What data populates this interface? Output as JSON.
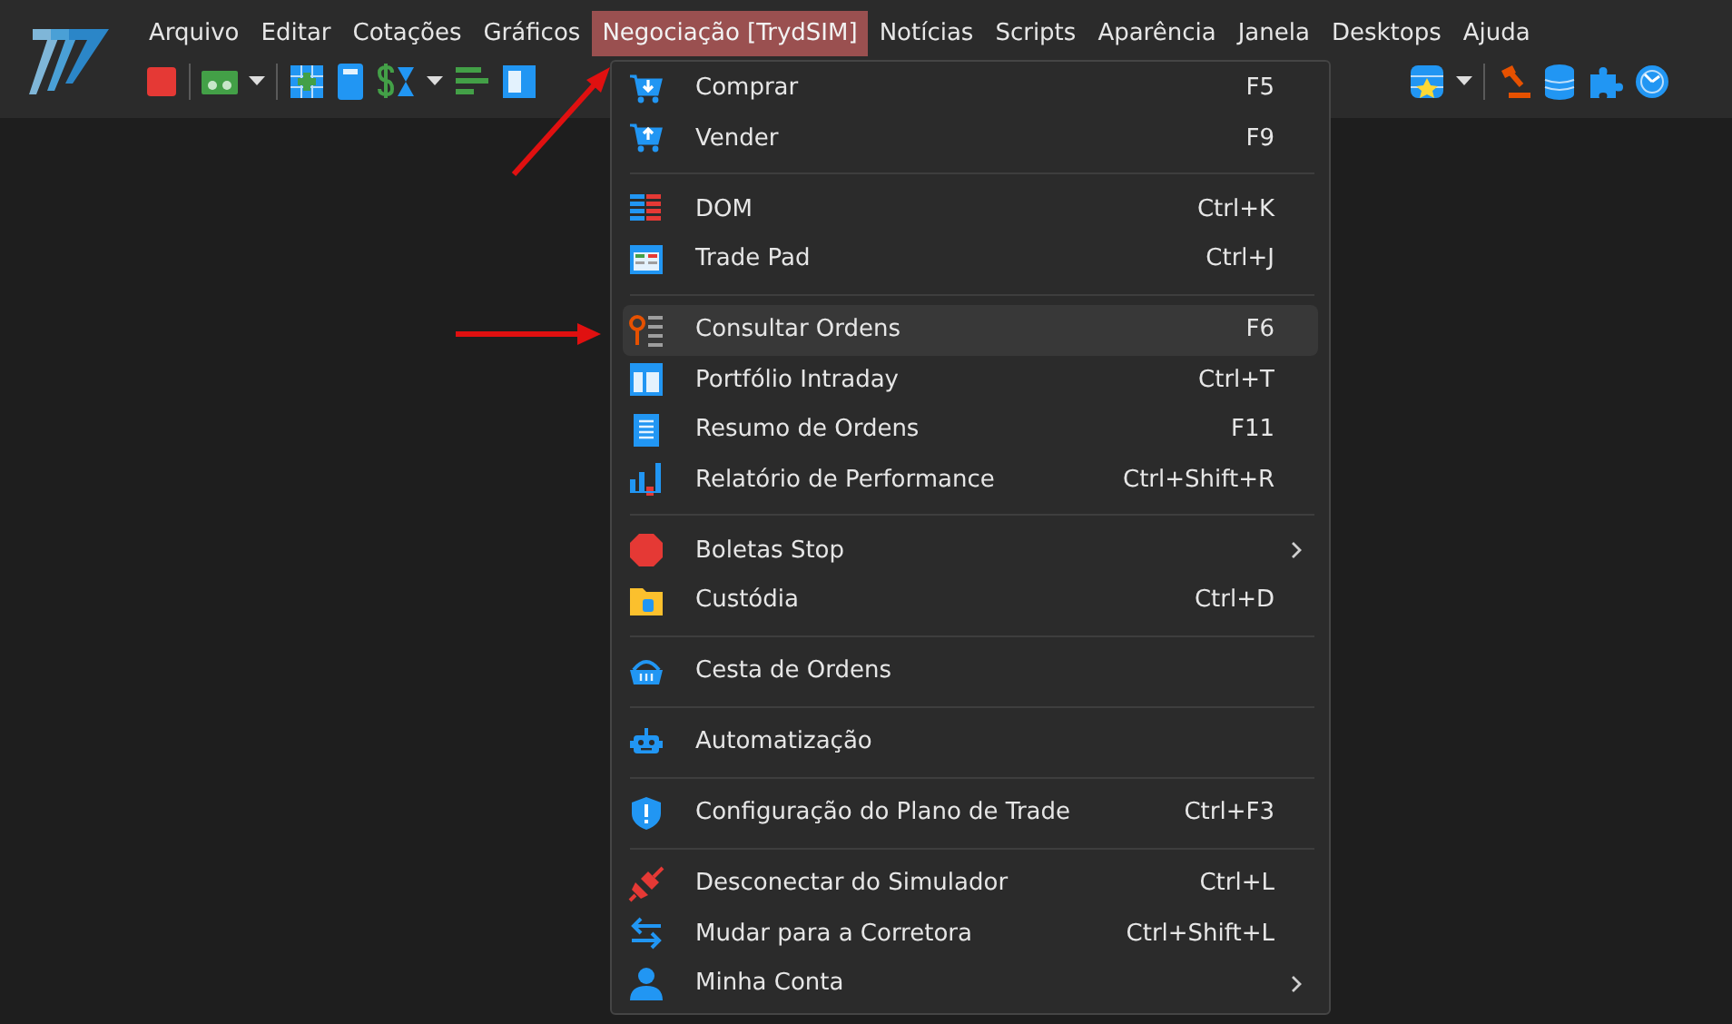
{
  "menu_bar": [
    {
      "label": "Arquivo",
      "selected": false
    },
    {
      "label": "Editar",
      "selected": false
    },
    {
      "label": "Cotações",
      "selected": false
    },
    {
      "label": "Gráficos",
      "selected": false
    },
    {
      "label": "Negociação [TrydSIM]",
      "selected": true
    },
    {
      "label": "Notícias",
      "selected": false
    },
    {
      "label": "Scripts",
      "selected": false
    },
    {
      "label": "Aparência",
      "selected": false
    },
    {
      "label": "Janela",
      "selected": false
    },
    {
      "label": "Desktops",
      "selected": false
    },
    {
      "label": "Ajuda",
      "selected": false
    }
  ],
  "menu": {
    "sections": [
      {
        "items": [
          {
            "label": "Comprar",
            "shortcut": "F5",
            "submenu": false,
            "selected": false
          },
          {
            "label": "Vender",
            "shortcut": "F9",
            "submenu": false,
            "selected": false
          }
        ]
      },
      {
        "items": [
          {
            "label": "DOM",
            "shortcut": "Ctrl+K",
            "submenu": false,
            "selected": false
          },
          {
            "label": "Trade Pad",
            "shortcut": "Ctrl+J",
            "submenu": false,
            "selected": false
          }
        ]
      },
      {
        "items": [
          {
            "label": "Consultar Ordens",
            "shortcut": "F6",
            "submenu": false,
            "selected": true
          },
          {
            "label": "Portfólio Intraday",
            "shortcut": "Ctrl+T",
            "submenu": false,
            "selected": false
          },
          {
            "label": "Resumo de Ordens",
            "shortcut": "F11",
            "submenu": false,
            "selected": false
          },
          {
            "label": "Relatório de Performance",
            "shortcut": "Ctrl+Shift+R",
            "submenu": false,
            "selected": false
          }
        ]
      },
      {
        "items": [
          {
            "label": "Boletas Stop",
            "submenu": true,
            "selected": false
          },
          {
            "label": "Custódia",
            "shortcut": "Ctrl+D",
            "submenu": false,
            "selected": false
          }
        ]
      },
      {
        "items": [
          {
            "label": "Cesta de Ordens",
            "submenu": false,
            "selected": false
          }
        ]
      },
      {
        "items": [
          {
            "label": "Automatização",
            "submenu": false,
            "selected": false
          }
        ]
      },
      {
        "items": [
          {
            "label": "Configuração do Plano de Trade",
            "shortcut": "Ctrl+F3",
            "submenu": false,
            "selected": false
          }
        ]
      },
      {
        "items": [
          {
            "label": "Desconectar do Simulador",
            "shortcut": "Ctrl+L",
            "submenu": false,
            "selected": false
          },
          {
            "label": "Mudar para a Corretora",
            "shortcut": "Ctrl+Shift+L",
            "submenu": false,
            "selected": false
          },
          {
            "label": "Minha Conta",
            "submenu": true,
            "selected": false
          }
        ]
      }
    ]
  }
}
